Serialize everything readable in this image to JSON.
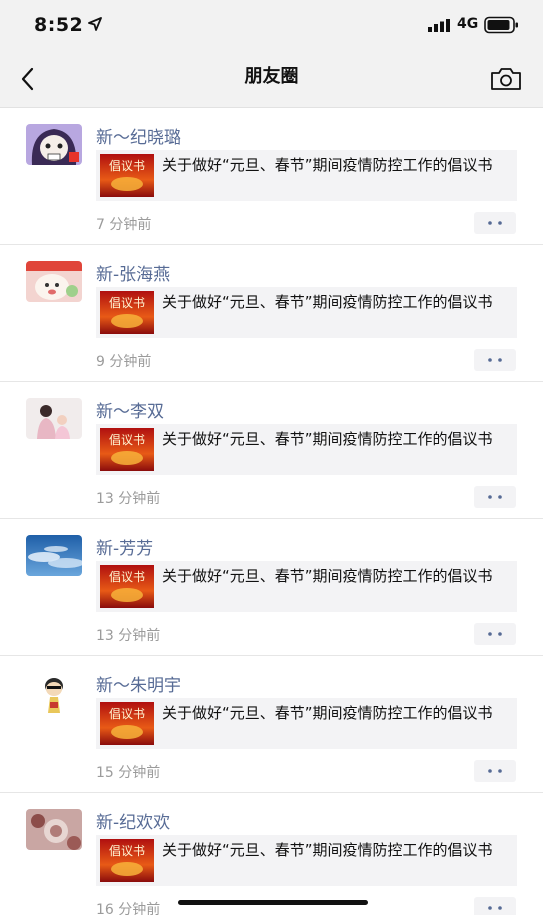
{
  "status_bar": {
    "time": "8:52",
    "network": "4G"
  },
  "nav": {
    "title": "朋友圈"
  },
  "share_title": "关于做好“元旦、春节”期间疫情防控工作的倡议书",
  "share_thumb_text": "倡议书",
  "posts": [
    {
      "name": "新～纪晓璐",
      "time": "7 分钟前"
    },
    {
      "name": "新-张海燕",
      "time": "9 分钟前"
    },
    {
      "name": "新～李双",
      "time": "13 分钟前"
    },
    {
      "name": "新-芳芳",
      "time": "13 分钟前"
    },
    {
      "name": "新～朱明宇",
      "time": "15 分钟前"
    },
    {
      "name": "新-纪欢欢",
      "time": "16 分钟前"
    }
  ],
  "colors": {
    "name_link": "#576b95",
    "time_gray": "#9b9b9b",
    "bar_bg": "#f2f2f2",
    "card_bg": "#f3f3f5"
  },
  "icons": [
    "location-arrow-icon",
    "signal-icon",
    "battery-icon",
    "back-chevron-icon",
    "camera-icon",
    "more-dots-icon"
  ]
}
